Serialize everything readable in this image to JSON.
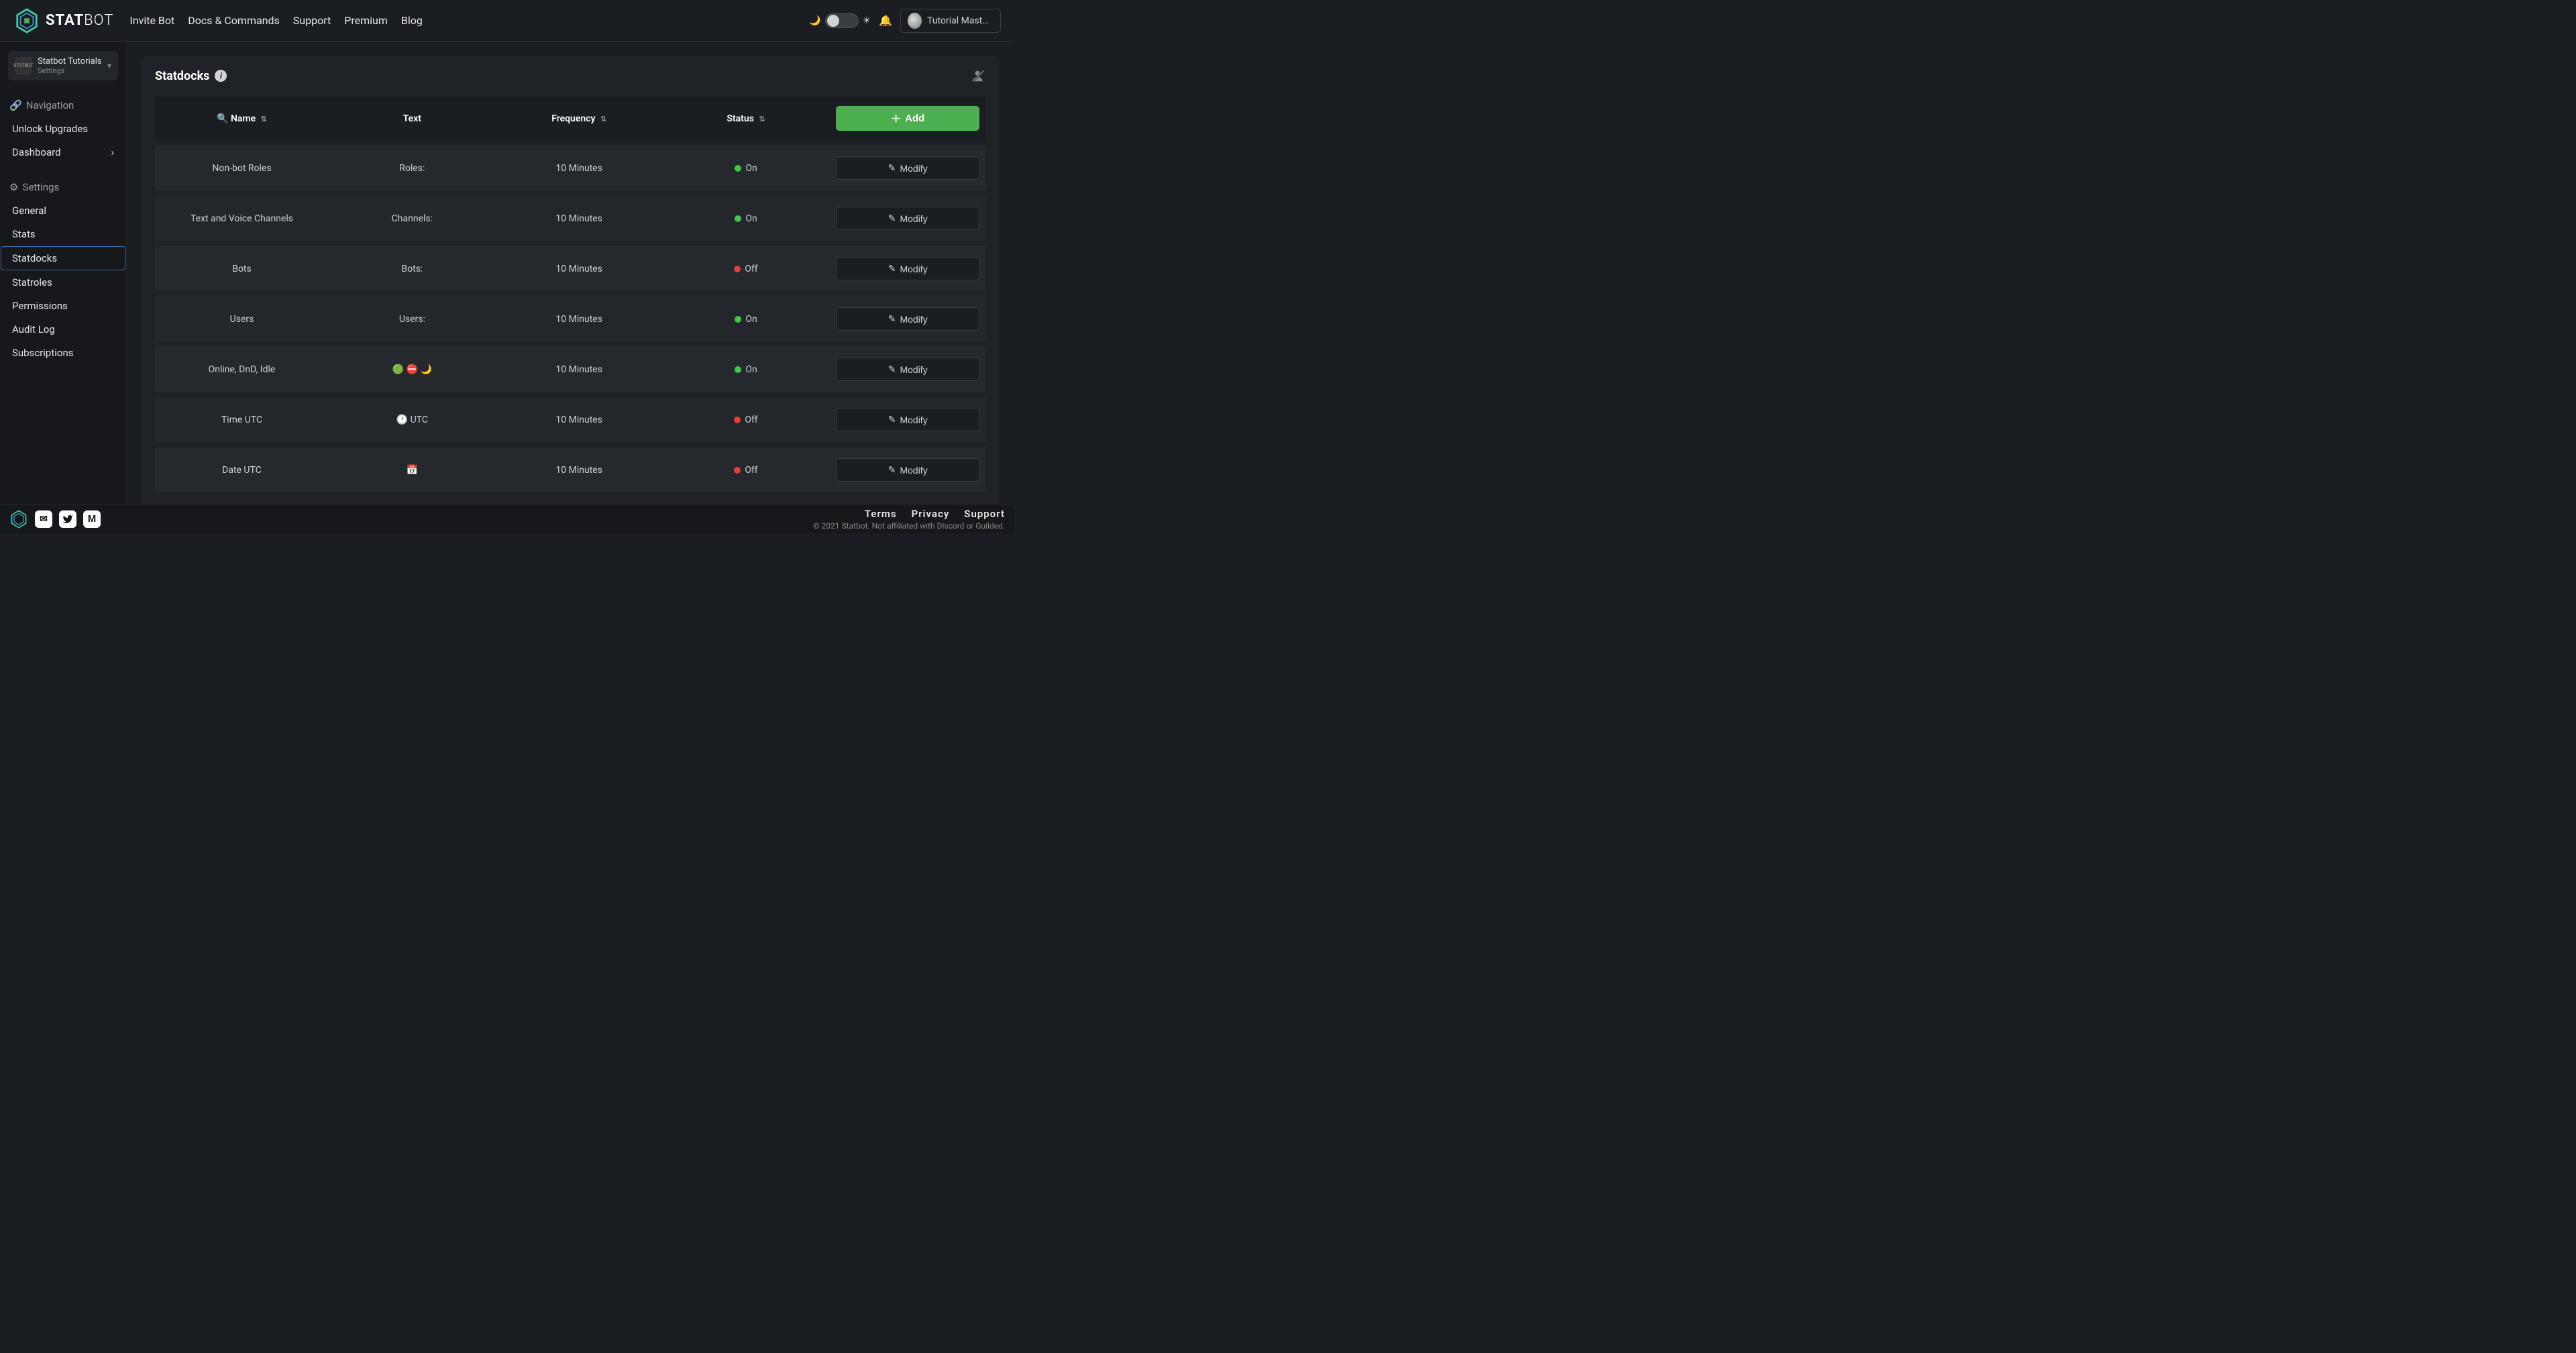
{
  "header": {
    "brand": "STATBOT",
    "nav": [
      "Invite Bot",
      "Docs & Commands",
      "Support",
      "Premium",
      "Blog"
    ],
    "username": "Tutorial Master#…"
  },
  "sidebar": {
    "server": {
      "name": "Statbot Tutorials",
      "sub": "Settings"
    },
    "navigation": {
      "heading": "Navigation",
      "items": [
        "Unlock Upgrades",
        "Dashboard"
      ]
    },
    "settings": {
      "heading": "Settings",
      "items": [
        "General",
        "Stats",
        "Statdocks",
        "Statroles",
        "Permissions",
        "Audit Log",
        "Subscriptions"
      ],
      "active": "Statdocks"
    }
  },
  "panel": {
    "title": "Statdocks",
    "columns": {
      "name": "Name",
      "text": "Text",
      "freq": "Frequency",
      "status": "Status"
    },
    "add_label": "Add",
    "modify_label": "Modify",
    "rows": [
      {
        "name": "Non-bot Roles",
        "text": "Roles: <counter>",
        "freq": "10 Minutes",
        "status": "On"
      },
      {
        "name": "Text and Voice Channels",
        "text": "Channels: <counter>",
        "freq": "10 Minutes",
        "status": "On"
      },
      {
        "name": "Bots",
        "text": "Bots: <counter>",
        "freq": "10 Minutes",
        "status": "Off"
      },
      {
        "name": "Users",
        "text": "Users: <counter>",
        "freq": "10 Minutes",
        "status": "On"
      },
      {
        "name": "Online, DnD, Idle",
        "text": "🟢 <counter>  ⛔ <counter>  🌙 <counter>",
        "freq": "10 Minutes",
        "status": "On"
      },
      {
        "name": "Time UTC",
        "text": "🕐 <counter> UTC",
        "freq": "10 Minutes",
        "status": "Off"
      },
      {
        "name": "Date UTC",
        "text": "📅 <counter>",
        "freq": "10 Minutes",
        "status": "Off"
      }
    ]
  },
  "footer": {
    "links": [
      "Terms",
      "Privacy",
      "Support"
    ],
    "copyright": "© 2021 Statbot. Not affiliated with Discord or Guilded."
  }
}
